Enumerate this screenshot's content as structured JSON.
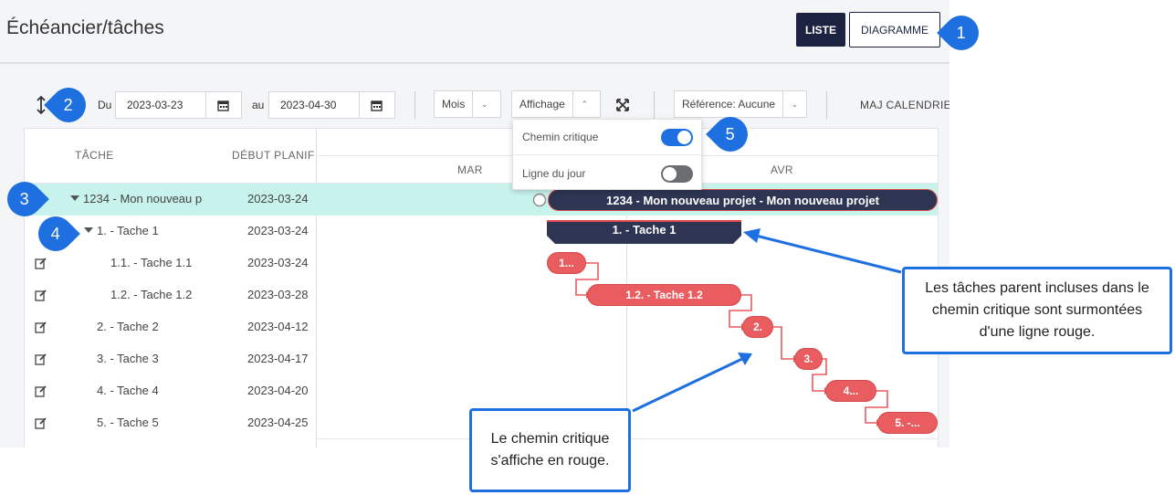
{
  "header": {
    "title": "Échéancier/tâches",
    "btn_list": "LISTE",
    "btn_diagram": "DIAGRAMME"
  },
  "toolbar": {
    "from_label": "Du",
    "from_value": "2023-03-23",
    "to_label": "au",
    "to_value": "2023-04-30",
    "period": "Mois",
    "display": "Affichage",
    "reference": "Référence: Aucune",
    "update_calendar": "MAJ CALENDRIER"
  },
  "dropdown": {
    "critical_path": "Chemin critique",
    "critical_path_on": true,
    "today_line": "Ligne du jour",
    "today_line_on": false
  },
  "grid": {
    "col_task": "TÂCHE",
    "col_start": "DÉBUT PLANIF",
    "month_mar": "MAR",
    "month_apr": "AVR",
    "rows": [
      {
        "name": "1234 - Mon nouveau p",
        "date": "2023-03-24"
      },
      {
        "name": "1. - Tache 1",
        "date": "2023-03-24"
      },
      {
        "name": "1.1. - Tache 1.1",
        "date": "2023-03-24"
      },
      {
        "name": "1.2. - Tache 1.2",
        "date": "2023-03-28"
      },
      {
        "name": "2. - Tache 2",
        "date": "2023-04-12"
      },
      {
        "name": "3. - Tache 3",
        "date": "2023-04-17"
      },
      {
        "name": "4. - Tache 4",
        "date": "2023-04-20"
      },
      {
        "name": "5. - Tache 5",
        "date": "2023-04-25"
      }
    ]
  },
  "bars": {
    "project": "1234 - Mon nouveau projet - Mon nouveau projet",
    "parent": "1. - Tache 1",
    "t11": "1...",
    "t12": "1.2. - Tache 1.2",
    "t2": "2.",
    "t3": "3.",
    "t4": "4...",
    "t5": "5. -..."
  },
  "callouts": {
    "b1": "1",
    "b2": "2",
    "b3": "3",
    "b4": "4",
    "b5": "5",
    "note_parent": "Les tâches parent incluses dans le chemin critique sont surmontées d'une ligne rouge.",
    "note_critical": "Le chemin critique s'affiche en rouge."
  },
  "colors": {
    "accent": "#1e6fe0",
    "critical": "#e95c5f",
    "dark_bar": "#2d3553",
    "highlight_row": "#c8f2ec"
  }
}
